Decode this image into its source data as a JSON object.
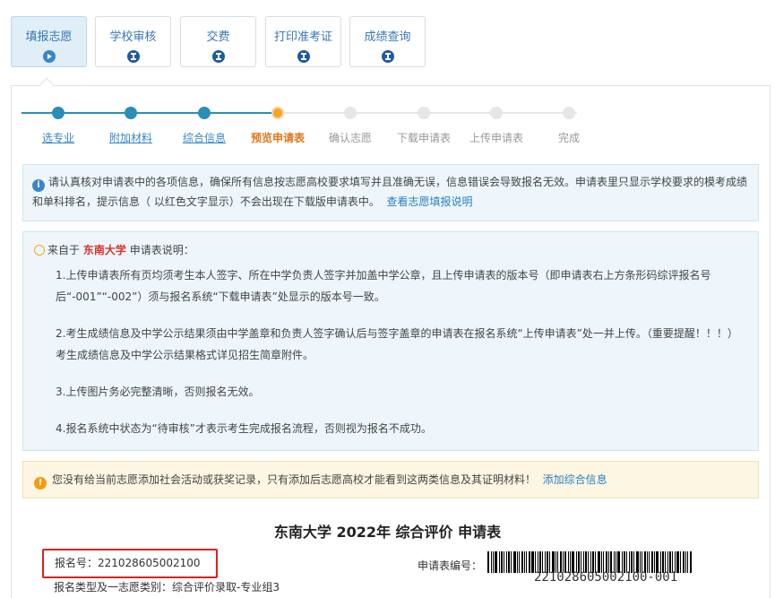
{
  "tabs": [
    {
      "label": "填报志愿",
      "icon": "play-icon",
      "active": true
    },
    {
      "label": "学校审核",
      "icon": "hourglass-icon"
    },
    {
      "label": "交费",
      "icon": "hourglass-icon"
    },
    {
      "label": "打印准考证",
      "icon": "hourglass-icon"
    },
    {
      "label": "成绩查询",
      "icon": "hourglass-icon"
    }
  ],
  "steps": [
    {
      "label": "选专业",
      "status": "done"
    },
    {
      "label": "附加材料",
      "status": "done"
    },
    {
      "label": "综合信息",
      "status": "done"
    },
    {
      "label": "预览申请表",
      "status": "current"
    },
    {
      "label": "确认志愿",
      "status": "todo"
    },
    {
      "label": "下载申请表",
      "status": "todo"
    },
    {
      "label": "上传申请表",
      "status": "todo"
    },
    {
      "label": "完成",
      "status": "todo"
    }
  ],
  "info": {
    "text": "请认真核对申请表中的各项信息，确保所有信息按志愿高校要求填写并且准确无误，信息错误会导致报名无效。申请表里只显示学校要求的模考成绩和单科排名，提示信息（ 以红色文字显示）不会出现在下载版申请表中。",
    "link": "查看志愿填报说明"
  },
  "note": {
    "prefix": "来自于",
    "university": "东南大学",
    "suffix": "申请表说明：",
    "items": [
      "1.上传申请表所有页均须考生本人签字、所在中学负责人签字并加盖中学公章，且上传申请表的版本号（即申请表右上方条形码综评报名号后“-001”“-002”）须与报名系统“下载申请表”处显示的版本号一致。",
      "2.考生成绩信息及中学公示结果须由中学盖章和负责人签字确认后与签字盖章的申请表在报名系统“上传申请表”处一并上传。（重要提醒！！！）考生成绩信息及中学公示结果格式详见招生简章附件。",
      "3.上传图片务必完整清晰，否则报名无效。",
      "4.报名系统中状态为“待审核”才表示考生完成报名流程，否则视为报名不成功。"
    ]
  },
  "warning": {
    "text": "您没有给当前志愿添加社会活动或获奖记录，只有添加后志愿高校才能看到这两类信息及其证明材料！",
    "link": "添加综合信息"
  },
  "form": {
    "title": "东南大学 2022年 综合评价 申请表",
    "reg_no": "报名号：221028605002100",
    "reg_type": "报名类型及一志愿类别：综合评价录取-专业组3",
    "app_no_label": "申请表编号：",
    "barcode_text": "221028605002100-001"
  },
  "colors": {
    "accent": "#3a86c6",
    "current_step": "#f5a623",
    "highlight_border": "#e02020",
    "university": "#d9322b"
  }
}
